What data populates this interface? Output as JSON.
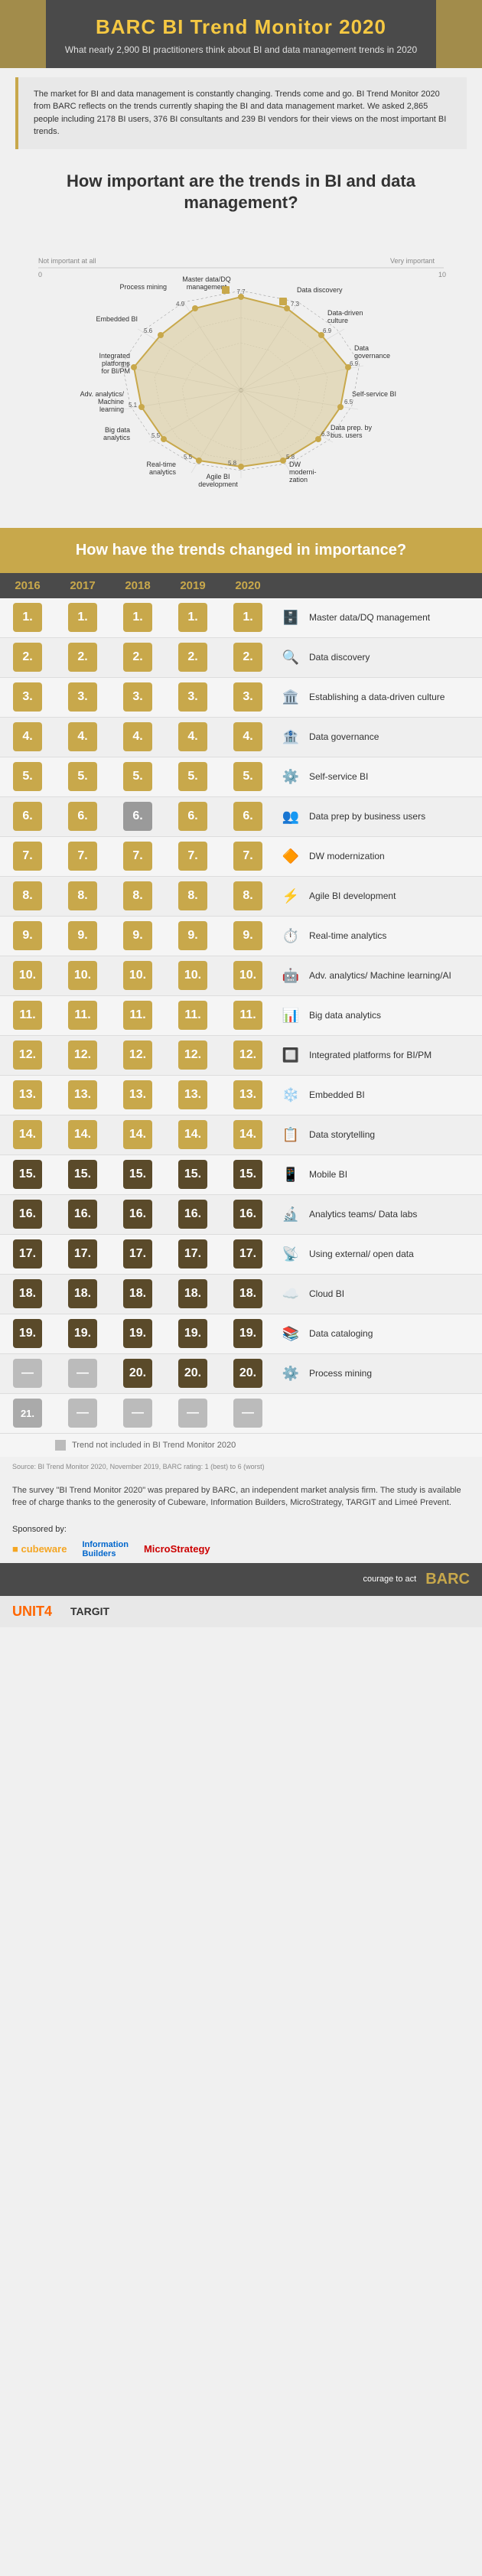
{
  "header": {
    "title": "BARC BI Trend Monitor 2020",
    "subtitle": "What nearly 2,900 BI practitioners think about BI and data management trends in 2020"
  },
  "intro": "The market for BI and data management is constantly changing. Trends come and go. BI Trend Monitor 2020 from BARC reflects on the trends currently shaping the BI and data management market. We asked 2,865 people including 2178 BI users, 376 BI consultants and 239 BI vendors for their views on the most important BI trends.",
  "section1_heading": "How important are the trends in BI and data management?",
  "section2_heading": "How have the trends changed in importance?",
  "years": [
    "2016",
    "2017",
    "2018",
    "2019",
    "2020"
  ],
  "trends": [
    {
      "ranks": [
        "1",
        "1",
        "1",
        "1",
        "1"
      ],
      "name": "Master data/DQ management",
      "icon": "🗄️",
      "type": "gold"
    },
    {
      "ranks": [
        "2",
        "2",
        "2",
        "2",
        "2"
      ],
      "name": "Data discovery",
      "icon": "🔍",
      "type": "gold"
    },
    {
      "ranks": [
        "3",
        "3",
        "3",
        "3",
        "3"
      ],
      "name": "Establishing a data-driven culture",
      "icon": "🏛️",
      "type": "gold"
    },
    {
      "ranks": [
        "4",
        "4",
        "4",
        "4",
        "4"
      ],
      "name": "Data governance",
      "icon": "🏦",
      "type": "gold"
    },
    {
      "ranks": [
        "5",
        "5",
        "5",
        "5",
        "5"
      ],
      "name": "Self-service BI",
      "icon": "⚙️",
      "type": "gold"
    },
    {
      "ranks": [
        "6",
        "6",
        "6",
        "6",
        "6"
      ],
      "name": "Data prep by business users",
      "icon": "👥",
      "type": "gold"
    },
    {
      "ranks": [
        "7",
        "7",
        "7",
        "7",
        "7"
      ],
      "name": "DW modernization",
      "icon": "🔶",
      "type": "gold"
    },
    {
      "ranks": [
        "8",
        "8",
        "8",
        "8",
        "8"
      ],
      "name": "Agile BI development",
      "icon": "⚡",
      "type": "gold"
    },
    {
      "ranks": [
        "9",
        "9",
        "9",
        "9",
        "9"
      ],
      "name": "Real-time analytics",
      "icon": "⏱️",
      "type": "gold"
    },
    {
      "ranks": [
        "10",
        "10",
        "10",
        "10",
        "10"
      ],
      "name": "Adv. analytics/ Machine learning/AI",
      "icon": "🤖",
      "type": "gold"
    },
    {
      "ranks": [
        "11",
        "11",
        "11",
        "11",
        "11"
      ],
      "name": "Big data analytics",
      "icon": "📊",
      "type": "gold"
    },
    {
      "ranks": [
        "12",
        "12",
        "12",
        "12",
        "12"
      ],
      "name": "Integrated platforms for BI/PM",
      "icon": "🔲",
      "type": "gold"
    },
    {
      "ranks": [
        "13",
        "13",
        "13",
        "13",
        "13"
      ],
      "name": "Embedded BI",
      "icon": "❄️",
      "type": "gold"
    },
    {
      "ranks": [
        "14",
        "14",
        "14",
        "14",
        "14"
      ],
      "name": "Data storytelling",
      "icon": "📋",
      "type": "gold"
    },
    {
      "ranks": [
        "15",
        "15",
        "15",
        "15",
        "15"
      ],
      "name": "Mobile BI",
      "icon": "📱",
      "type": "dark"
    },
    {
      "ranks": [
        "16",
        "16",
        "16",
        "16",
        "16"
      ],
      "name": "Analytics teams/ Data labs",
      "icon": "🔬",
      "type": "dark"
    },
    {
      "ranks": [
        "17",
        "17",
        "17",
        "17",
        "17"
      ],
      "name": "Using external/ open data",
      "icon": "📡",
      "type": "dark"
    },
    {
      "ranks": [
        "18",
        "18",
        "18",
        "18",
        "18"
      ],
      "name": "Cloud BI",
      "icon": "☁️",
      "type": "dark"
    },
    {
      "ranks": [
        "19",
        "19",
        "19",
        "19",
        "19"
      ],
      "name": "Data cataloging",
      "icon": "📚",
      "type": "dark"
    },
    {
      "ranks": [
        "-",
        "-",
        "20",
        "20",
        "20"
      ],
      "name": "Process mining",
      "icon": "⚙️",
      "type": "dark"
    },
    {
      "ranks": [
        "21",
        "-",
        "-",
        "-",
        "-"
      ],
      "name": "",
      "icon": "",
      "type": "gray",
      "extra": true
    }
  ],
  "no_data_label": "Trend not included in BI Trend Monitor 2020",
  "footer_source": "Source: BI Trend Monitor 2020, November 2019, BARC rating: 1 (best) to 6 (worst)",
  "footer_text": "The survey \"BI Trend Monitor 2020\" was prepared by BARC, an independent market analysis firm. The study is available free of charge thanks to the generosity of Cubeware, Information Builders, MicroStrategy, TARGIT and Limeé Prevent.",
  "sponsored_by": "Sponsored by:",
  "sponsors": [
    "cubeware",
    "Information Builders",
    "MicroStrategy"
  ],
  "bottom_sponsors": [
    "UNIT4",
    "TARGIT"
  ],
  "barc_label": "courage to act",
  "barc_brand": "BARC"
}
